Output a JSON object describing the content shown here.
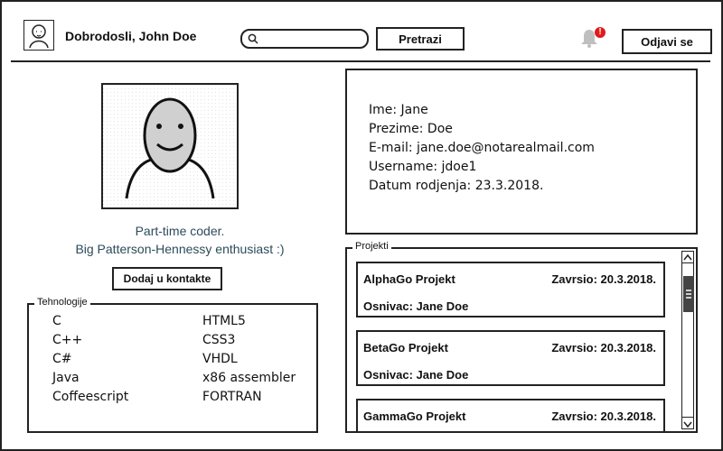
{
  "header": {
    "welcome": "Dobrodosli, John Doe",
    "search_placeholder": "",
    "search_button": "Pretrazi",
    "notification_count": "!",
    "logout_button": "Odjavi se"
  },
  "profile": {
    "bio_line1": "Part-time coder.",
    "bio_line2": "Big Patterson-Hennessy enthusiast :)",
    "add_contact_button": "Dodaj u kontakte"
  },
  "technologies": {
    "title": "Tehnologije",
    "col1": [
      "C",
      "C++",
      "C#",
      "Java",
      "Coffeescript"
    ],
    "col2": [
      "HTML5",
      "CSS3",
      "VHDL",
      "x86 assembler",
      "FORTRAN"
    ]
  },
  "info": {
    "lines": [
      "Ime: Jane",
      "Prezime: Doe",
      "E-mail: jane.doe@notarealmail.com",
      "Username: jdoe1",
      "Datum rodjenja: 23.3.2018."
    ]
  },
  "projects": {
    "title": "Projekti",
    "items": [
      {
        "name": "AlphaGo Projekt",
        "done": "Zavrsio: 20.3.2018.",
        "owner": "Osnivac: Jane Doe"
      },
      {
        "name": "BetaGo Projekt",
        "done": "Zavrsio: 20.3.2018.",
        "owner": "Osnivac: Jane Doe"
      },
      {
        "name": "GammaGo Projekt",
        "done": "Zavrsio: 20.3.2018.",
        "owner": ""
      }
    ]
  },
  "icons": {
    "user_avatar": "user-avatar-icon",
    "search": "search-icon",
    "bell": "bell-icon"
  },
  "colors": {
    "bio_text": "#2c4b5a",
    "notification_badge": "#e21a1a"
  }
}
